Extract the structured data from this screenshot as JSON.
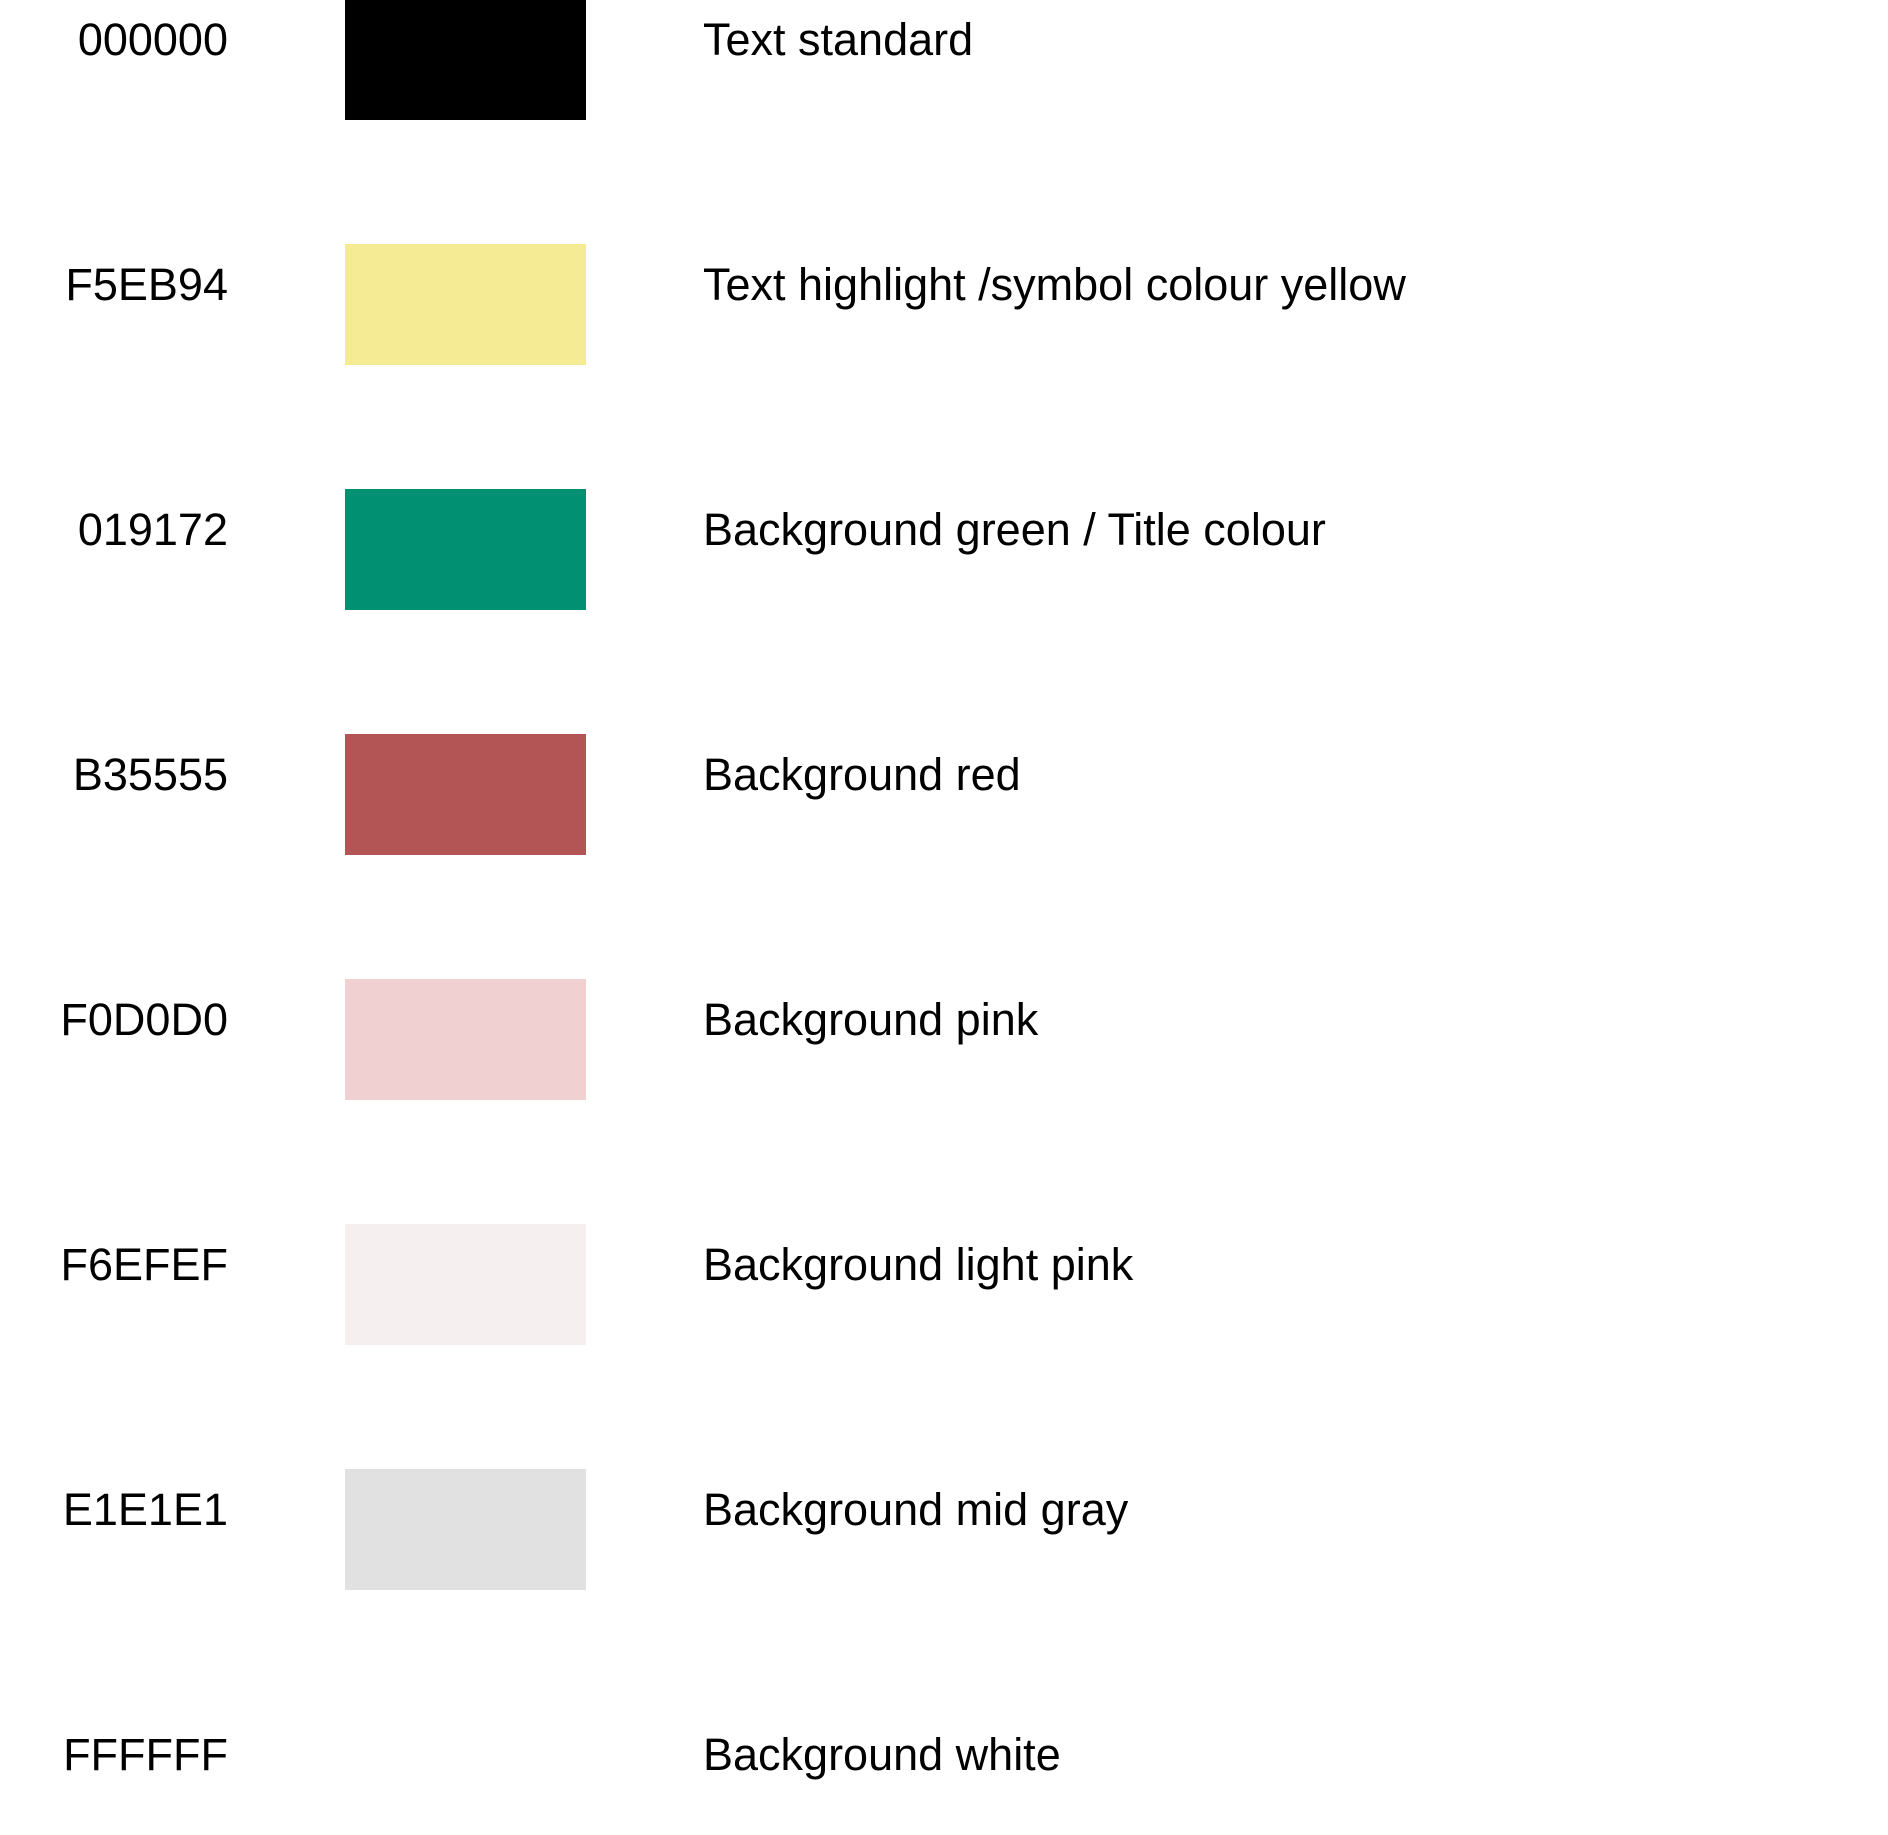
{
  "palette": {
    "swatches": [
      {
        "hex": "000000",
        "description": "Text standard",
        "color": "#000000"
      },
      {
        "hex": "F5EB94",
        "description": "Text highlight /symbol colour yellow",
        "color": "#F5EB94"
      },
      {
        "hex": "019172",
        "description": "Background green / Title colour",
        "color": "#019172"
      },
      {
        "hex": "B35555",
        "description": "Background red",
        "color": "#B35555"
      },
      {
        "hex": "F0D0D0",
        "description": "Background pink",
        "color": "#F0D0D0"
      },
      {
        "hex": "F6EFEF",
        "description": "Background light pink",
        "color": "#F6EFEF"
      },
      {
        "hex": "E1E1E1",
        "description": "Background mid gray",
        "color": "#E1E1E1"
      },
      {
        "hex": "FFFFFF",
        "description": "Background white",
        "color": "#FFFFFF"
      }
    ]
  }
}
